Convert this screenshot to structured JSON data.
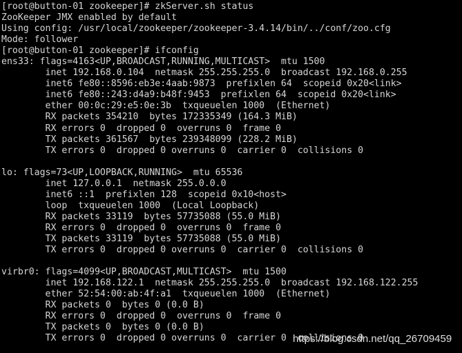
{
  "terminal": {
    "background_color": "#000000",
    "text_color": "#d6d6d6",
    "lines": [
      "[root@button-01 zookeeper]# zkServer.sh status",
      "ZooKeeper JMX enabled by default",
      "Using config: /usr/local/zookeeper/zookeeper-3.4.14/bin/../conf/zoo.cfg",
      "Mode: follower",
      "[root@button-01 zookeeper]# ifconfig",
      "ens33: flags=4163<UP,BROADCAST,RUNNING,MULTICAST>  mtu 1500",
      "        inet 192.168.0.104  netmask 255.255.255.0  broadcast 192.168.0.255",
      "        inet6 fe80::8596:eb3e:4aab:9873  prefixlen 64  scopeid 0x20<link>",
      "        inet6 fe80::243:d4a9:b48f:9453  prefixlen 64  scopeid 0x20<link>",
      "        ether 00:0c:29:e5:0e:3b  txqueuelen 1000  (Ethernet)",
      "        RX packets 354210  bytes 172335349 (164.3 MiB)",
      "        RX errors 0  dropped 0  overruns 0  frame 0",
      "        TX packets 361567  bytes 239348099 (228.2 MiB)",
      "        TX errors 0  dropped 0 overruns 0  carrier 0  collisions 0",
      "",
      "lo: flags=73<UP,LOOPBACK,RUNNING>  mtu 65536",
      "        inet 127.0.0.1  netmask 255.0.0.0",
      "        inet6 ::1  prefixlen 128  scopeid 0x10<host>",
      "        loop  txqueuelen 1000  (Local Loopback)",
      "        RX packets 33119  bytes 57735088 (55.0 MiB)",
      "        RX errors 0  dropped 0  overruns 0  frame 0",
      "        TX packets 33119  bytes 57735088 (55.0 MiB)",
      "        TX errors 0  dropped 0 overruns 0  carrier 0  collisions 0",
      "",
      "virbr0: flags=4099<UP,BROADCAST,MULTICAST>  mtu 1500",
      "        inet 192.168.122.1  netmask 255.255.255.0  broadcast 192.168.122.255",
      "        ether 52:54:00:ab:4f:a1  txqueuelen 1000  (Ethernet)",
      "        RX packets 0  bytes 0 (0.0 B)",
      "        RX errors 0  dropped 0  overruns 0  frame 0",
      "        TX packets 0  bytes 0 (0.0 B)",
      "        TX errors 0  dropped 0 overruns 0  carrier 0  collisions 0"
    ]
  },
  "watermark": {
    "text": "https://blog.csdn.net/qq_26709459"
  }
}
